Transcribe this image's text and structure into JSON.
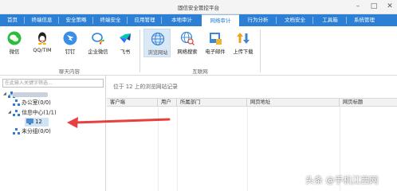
{
  "window": {
    "title": "固信安全管控平台"
  },
  "menu": {
    "items": [
      {
        "label": "首页"
      },
      {
        "label": "终端信息"
      },
      {
        "label": "安全策略"
      },
      {
        "label": "终端安全"
      },
      {
        "label": "应用管理"
      },
      {
        "label": "本地审计"
      },
      {
        "label": "网络审计"
      },
      {
        "label": "行为分析"
      },
      {
        "label": "文档安全"
      },
      {
        "label": "工具箱"
      },
      {
        "label": "系统管理"
      }
    ],
    "active": "网络审计"
  },
  "ribbon": {
    "groups": [
      {
        "label": "聊天内容",
        "tools": [
          "微信",
          "QQ/TIM",
          "钉钉",
          "企业微信",
          "飞书"
        ]
      },
      {
        "label": "互联网",
        "tools": [
          "浏览网站",
          "网络搜索",
          "电子邮件",
          "上传下载"
        ]
      }
    ],
    "active_tool": "浏览网站"
  },
  "left": {
    "search_placeholder": "在此输入关键字筛选...",
    "tree": {
      "office": "办公室(0/0)",
      "info_center": "信息中心(1/1)",
      "device": "12",
      "ungrouped": "未分组(0/0)"
    }
  },
  "content": {
    "title": "位于 12 上的浏览网站记录",
    "columns": [
      "客户端",
      "用户",
      "所属部门",
      "网页地址",
      "网页标题"
    ]
  },
  "watermark": "头条 @手机江西网",
  "colors": {
    "menu_bg": "#2b7fd4",
    "arrow": "#e84040"
  }
}
